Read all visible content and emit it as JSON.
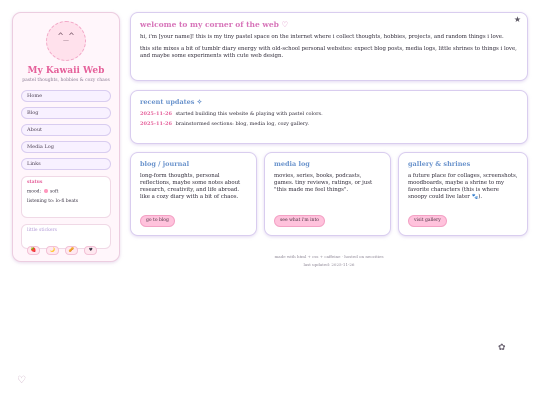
{
  "sidebar": {
    "avatar_face": "^_^",
    "title": "My Kawaii Web",
    "tagline": "pastel thoughts, hobbies & cozy chaos",
    "nav": [
      {
        "label": "Home"
      },
      {
        "label": "Blog"
      },
      {
        "label": "About"
      },
      {
        "label": "Media Log"
      },
      {
        "label": "Links"
      }
    ],
    "status": {
      "heading": "status",
      "mood_label": "mood:",
      "mood_value": "soft",
      "listening": "listening to: lo-fi beats"
    },
    "stickers": {
      "heading": "little stickers",
      "items": [
        {
          "glyph": "🍓",
          "name": "strawberry-sticker"
        },
        {
          "glyph": "🌙",
          "name": "moon-sticker"
        },
        {
          "glyph": "🥜",
          "name": "peanut-sticker"
        },
        {
          "glyph": "♥",
          "name": "heart-sticker"
        }
      ]
    }
  },
  "welcome": {
    "title": "welcome to my corner of the web ♡",
    "p1": "hi, i'm [your name]! this is my tiny pastel space on the internet where i collect thoughts, hobbies, projects, and random things i love.",
    "p2": "this site mixes a bit of tumblr diary energy with old-school personal websites: expect blog posts, media logs, little shrines to things i love, and maybe some experiments with cute web design.",
    "star_icon": "★"
  },
  "updates": {
    "title": "recent updates ✧",
    "items": [
      {
        "date": "2025-11-26",
        "text": "started building this website & playing with pastel colors."
      },
      {
        "date": "2025-11-26",
        "text": "brainstormed sections: blog, media log, cozy gallery."
      }
    ]
  },
  "blog": {
    "title": "blog / journal",
    "text": "long-form thoughts, personal reflections, maybe some notes about research, creativity, and life abroad. like a cozy diary with a bit of chaos.",
    "button": "go to blog"
  },
  "media": {
    "title": "media log",
    "text": "movies, series, books, podcasts, games. tiny reviews, ratings, or just \"this made me feel things\".",
    "button": "see what i'm into"
  },
  "gallery": {
    "title": "gallery & shrines",
    "text": "a future place for collages, screenshots, moodboards, maybe a shrine to my favorite characters (this is where snoopy could live later 🐾).",
    "button": "visit gallery"
  },
  "footer": {
    "line1": "made with html + css + caffeine · hosted on neocities",
    "line2": "last updated: 2025-11-26"
  },
  "floating": {
    "flower_icon": "✿",
    "heart_icon": "♡"
  }
}
